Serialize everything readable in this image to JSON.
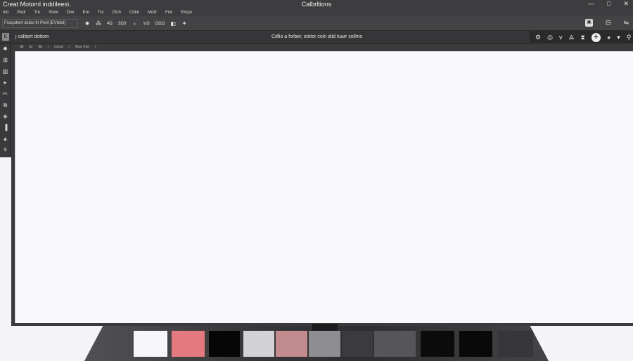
{
  "titlebar": {
    "app_title": "Creat Motoml inddilees\\.",
    "document_title": "Calbrltions",
    "controls": [
      "—",
      "□",
      "✕"
    ]
  },
  "menu": {
    "items": [
      "Ido",
      "Pedi",
      "Tre",
      "Stoie",
      "Dve",
      "Kre",
      "Tro",
      "Olch",
      "Cdkir",
      "Molir",
      "Fne",
      "Empo"
    ]
  },
  "toolbar": {
    "preset_value": "Frasjatterl dcibo th Prell (EVildol)",
    "tool_icons": [
      "✸",
      "⁂",
      "4Ω",
      "3Ω3",
      "⸗",
      "↯Ω",
      "ΩΩΩ",
      "◧",
      "✦"
    ],
    "right_icons": [
      "▣",
      "⊟",
      "⇋"
    ]
  },
  "doc_bar": {
    "home_icon": "E",
    "tab_label": "j calbert dottom",
    "status_text": "Cdfio a forber, stetor coln alid tuarr collms",
    "right_icons": [
      "⚙",
      "◎",
      "ᴠ",
      "⟁",
      "⧗",
      "+",
      "◕",
      "▾",
      "⚲"
    ]
  },
  "ruler": {
    "items": [
      "dlt",
      "lsr",
      "tlb",
      "/",
      "mosd",
      "/",
      "Aesr fron",
      "/"
    ]
  },
  "left_tools": [
    "✸",
    "⊞",
    "▥",
    "▸",
    "✂",
    "⧉",
    "◈",
    "▐",
    "▲",
    "⚘"
  ],
  "palette": {
    "swatches": [
      {
        "name": "white",
        "color": "#f7f7f9"
      },
      {
        "name": "pink",
        "color": "#e47a80"
      },
      {
        "name": "black",
        "color": "#060606"
      },
      {
        "name": "light-gray",
        "color": "#d3d3d7"
      },
      {
        "name": "dusty-rose",
        "color": "#c28c8f"
      },
      {
        "name": "mid-gray",
        "color": "#8d8d92"
      },
      {
        "name": "charcoal",
        "color": "#3b3b3d"
      },
      {
        "name": "slate",
        "color": "#56565a"
      },
      {
        "name": "black-2",
        "color": "#0b0b0c"
      },
      {
        "name": "black-3",
        "color": "#090909"
      },
      {
        "name": "dark-gray",
        "color": "#37373a"
      }
    ]
  }
}
